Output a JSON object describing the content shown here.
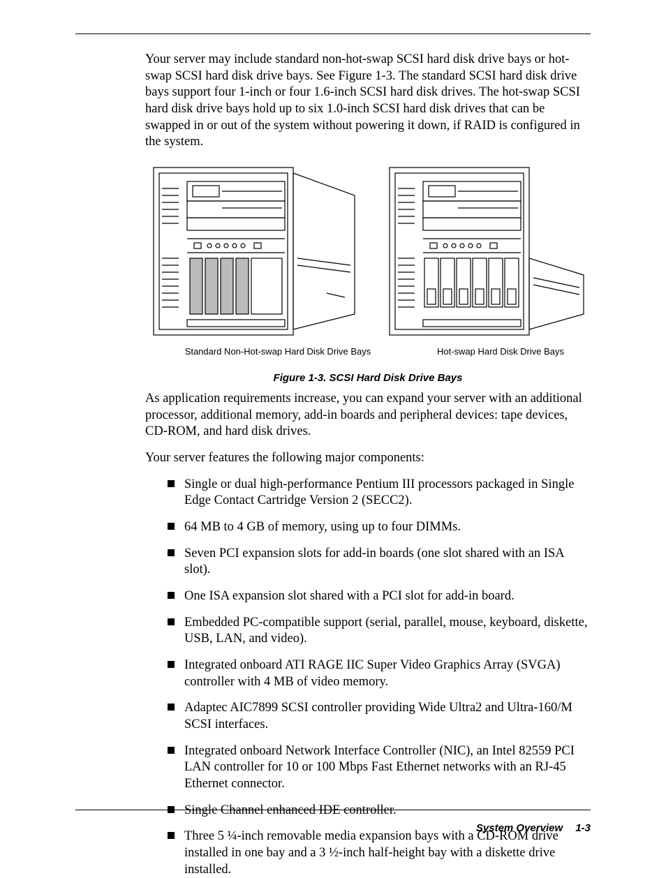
{
  "paragraphs": {
    "p1": "Your server may include standard non-hot-swap SCSI hard disk drive bays or hot-swap SCSI hard disk drive bays. See Figure 1-3. The standard SCSI hard disk drive bays support four 1-inch or four 1.6-inch SCSI hard disk drives. The hot-swap SCSI hard disk drive bays hold up to six 1.0-inch SCSI hard disk drives that can be swapped in or out of the system without powering it down, if RAID is configured in the system.",
    "p2": "As application requirements increase, you can expand your server with an additional processor, additional memory, add-in boards and peripheral devices: tape devices, CD-ROM, and hard disk drives.",
    "p3": "Your server features the following major components:"
  },
  "figure": {
    "label_left": "Standard Non-Hot-swap Hard Disk Drive Bays",
    "label_right": "Hot-swap Hard Disk Drive Bays",
    "caption": "Figure 1-3. SCSI Hard Disk Drive Bays"
  },
  "components": [
    "Single or dual high-performance Pentium III processors packaged in Single Edge Contact Cartridge Version 2 (SECC2).",
    "64 MB to 4 GB of memory, using up to four DIMMs.",
    "Seven PCI expansion slots for add-in boards (one slot shared with an ISA slot).",
    "One ISA expansion slot shared with a PCI slot for add-in board.",
    "Embedded PC-compatible support (serial, parallel, mouse, keyboard, diskette, USB, LAN, and video).",
    "Integrated onboard ATI RAGE IIC Super Video Graphics Array (SVGA) controller with 4 MB of video memory.",
    "Adaptec AIC7899 SCSI controller providing Wide Ultra2 and Ultra-160/M SCSI interfaces.",
    "Integrated onboard Network Interface Controller (NIC), an Intel 82559 PCI LAN controller for 10 or 100 Mbps Fast Ethernet networks with an RJ-45 Ethernet connector.",
    "Single Channel enhanced IDE controller.",
    "Three 5 ¼-inch removable media expansion bays with a CD-ROM drive installed in one bay and a 3 ½-inch half-height bay with a diskette drive installed."
  ],
  "footer": {
    "section": "System Overview",
    "page": "1-3"
  }
}
